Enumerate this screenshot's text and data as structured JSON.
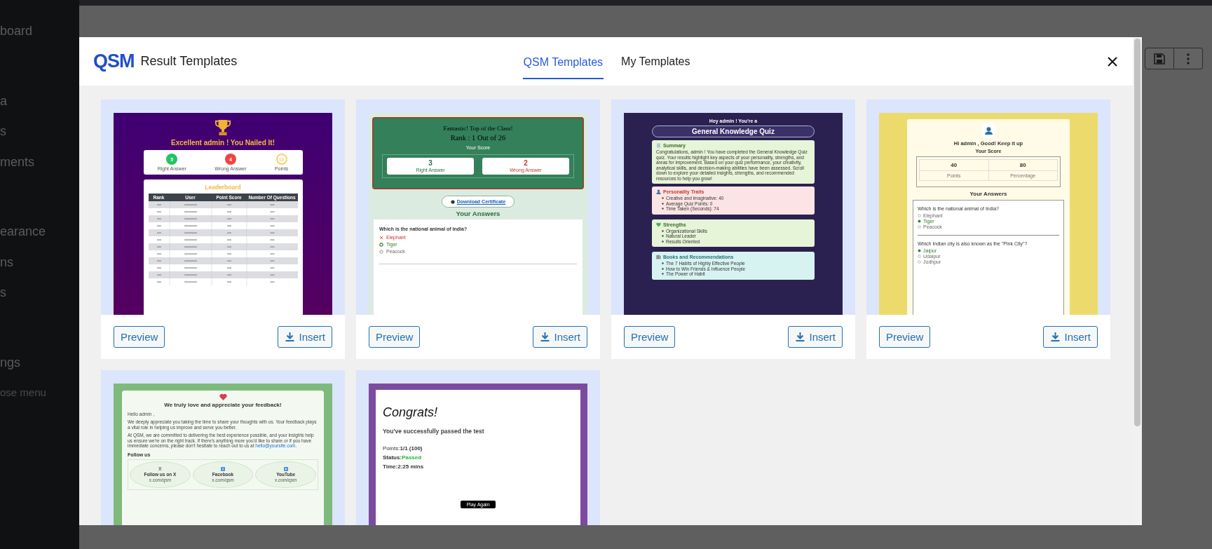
{
  "sidebar": {
    "groups": [
      [
        "board"
      ],
      [
        "a",
        "s",
        "ments"
      ],
      [
        "earance",
        "ns",
        "s"
      ],
      [
        "ngs",
        "ose menu"
      ]
    ]
  },
  "modal": {
    "logo": "QSM",
    "title": "Result Templates",
    "tabs": [
      {
        "label": "QSM Templates",
        "selected": true
      },
      {
        "label": "My Templates",
        "selected": false
      }
    ],
    "templates": [
      {
        "kind": "leaderboard",
        "actions": [
          "Preview",
          "Insert"
        ],
        "headline": "Excellent admin ! You Nailed It!",
        "stats": [
          {
            "value": "5",
            "label": "Right Answer",
            "color": "#22c55e",
            "kind": "filled"
          },
          {
            "value": "4",
            "label": "Wrong Answer",
            "color": "#ef4444",
            "kind": "filled"
          },
          {
            "value": "10",
            "label": "Points",
            "color": "#f6d36b",
            "kind": "outline"
          }
        ],
        "board_title": "Leaderboard",
        "columns": [
          "Rank",
          "User",
          "Point Score",
          "Number Of Questions"
        ]
      },
      {
        "kind": "scorecard",
        "actions": [
          "Preview",
          "Insert"
        ],
        "title": "Fantastic! Top of the Class!",
        "rank": "Rank : 1 Out of 26",
        "score_label": "Your Score",
        "stats": [
          {
            "value": "3",
            "label": "Right Answer",
            "color": "#2d6e4e"
          },
          {
            "value": "2",
            "label": "Wrong Answer",
            "color": "#c0392b"
          }
        ],
        "certificate": "Download Certificate",
        "answers_title": "Your Answers",
        "question": "Which is the national animal of India?",
        "options": [
          {
            "text": "Elephant",
            "kind": "wrong"
          },
          {
            "text": "Tiger",
            "kind": "correct"
          },
          {
            "text": "Peacock",
            "kind": "plain"
          }
        ]
      },
      {
        "kind": "personality",
        "actions": [
          "Preview",
          "Insert"
        ],
        "greeting": "Hey admin ! You're a",
        "quiz": "General Knowledge Quiz",
        "sections": [
          {
            "kind": "summary",
            "title": "Summary",
            "color": "#e6f4d7",
            "text": "Congratulations, admin ! You have completed the General Knowledge Quiz quiz. Your results highlight key aspects of your personality, strengths, and areas for improvement. Based on your quiz performance, your creativity, analytical skills, and decision-making abilities have been assessed. Scroll down to explore your detailed insights, strengths, and recommended resources to help you grow!"
          },
          {
            "kind": "traits",
            "title": "Personality Traits",
            "color": "#fde4e4",
            "items": [
              "Creative and imaginative: 40",
              "Average Quiz Points: 0",
              "Time Taken (Seconds): 74"
            ]
          },
          {
            "kind": "strengths",
            "title": "Strengths",
            "color": "#e6f4d7",
            "items": [
              "Organizational Skills",
              "Natural Leader",
              "Results Oriented"
            ]
          },
          {
            "kind": "books",
            "title": "Books and Recommendations",
            "color": "#d6f3f1",
            "items": [
              "The 7 Habits of Highly Effective People",
              "How to Win Friends & Influence People",
              "The Power of Habit"
            ]
          }
        ]
      },
      {
        "kind": "answers",
        "actions": [
          "Preview",
          "Insert"
        ],
        "greeting": "Hi admin , Good! Keep it up",
        "score_label": "Your Score",
        "stats": [
          {
            "value": "40",
            "label": "Points"
          },
          {
            "value": "80",
            "label": "Percentage"
          }
        ],
        "answers_title": "Your Answers",
        "questions": [
          {
            "text": "Which is the national animal of India?",
            "options": [
              {
                "text": "Elephant",
                "kind": "plain"
              },
              {
                "text": "Tiger",
                "kind": "correct"
              },
              {
                "text": "Peacock",
                "kind": "plain"
              }
            ]
          },
          {
            "text": "Which Indian city is also known as the \"Pink City\"?",
            "options": [
              {
                "text": "Jaipur",
                "kind": "correct"
              },
              {
                "text": "Udaipur",
                "kind": "plain"
              },
              {
                "text": "Jodhpur",
                "kind": "plain"
              }
            ]
          }
        ]
      },
      {
        "kind": "feedback",
        "title": "We truly love and appreciate your feedback!",
        "hello": "Hello admin ,",
        "paragraph": "We deeply appreciate you taking the time to share your thoughts with us. Your feedback plays a vital role in helping us improve and serve you better.",
        "paragraph_2": "At QSM, we are committed to delivering the best experience possible, and your insights help us ensure we're on the right track. If there's anything more you'd like to share or if you have immediate concerns, please don't hesitate to reach out to us at",
        "email": "hello@yoursite.com",
        "paragraph_end": ".",
        "follow": "Follow us",
        "socials": [
          {
            "kind": "glyph",
            "glyph": "X",
            "label": "Follow us on X",
            "handle": "x.com/qsm"
          },
          {
            "kind": "book",
            "label": "Facebook",
            "handle": "x.com/qsm"
          },
          {
            "kind": "play",
            "label": "YouTube",
            "handle": "x.com/qsm"
          }
        ]
      },
      {
        "kind": "congrats",
        "title": "Congrats!",
        "subtitle": "You've successfully passed the test",
        "lines": [
          {
            "label": "Points:",
            "value": "1/1 (100)",
            "kind": "plain"
          },
          {
            "label": "Status:",
            "value": "Passed",
            "kind": "status"
          },
          {
            "label": "Time:",
            "value": "2:25 mins",
            "kind": "bold"
          }
        ],
        "button": "Play Again"
      }
    ]
  }
}
